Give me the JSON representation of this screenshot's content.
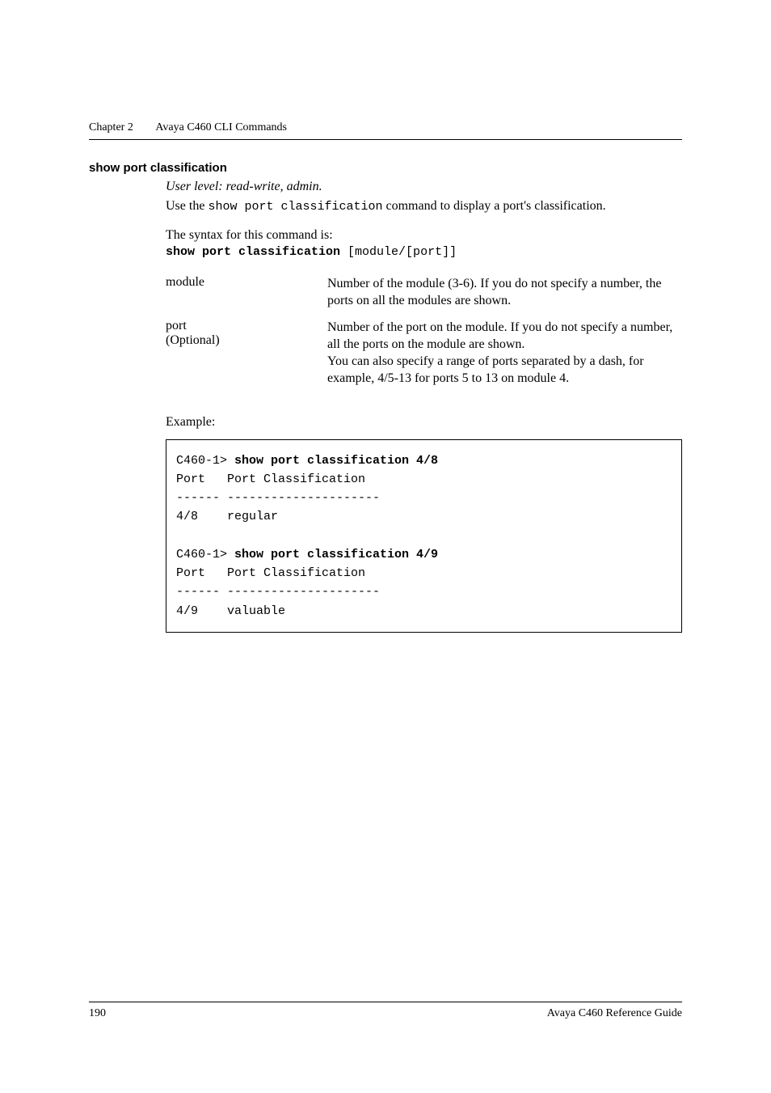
{
  "header": {
    "chapter_num": "Chapter 2",
    "chapter_title": "Avaya C460 CLI Commands"
  },
  "section": {
    "heading": "show port classification",
    "user_level": "User level: read-write, admin.",
    "intro_prefix": "Use the ",
    "intro_code": "show port classification",
    "intro_suffix": " command to display a port's classification.",
    "syntax_label": "The syntax for this command is:",
    "syntax_bold": "show port classification",
    "syntax_rest": " [module/[port]]"
  },
  "params": [
    {
      "name": "module",
      "optional": "",
      "desc": "Number of the module (3-6). If you do not specify a number, the ports on all the modules are shown."
    },
    {
      "name": "port",
      "optional": "(Optional)",
      "desc": "Number of the port on the module. If you do not specify a number, all the ports on the module are shown.",
      "desc2": "You can also specify a range of ports separated by a dash, for example, 4/5-13 for ports 5 to 13 on module 4."
    }
  ],
  "example": {
    "label": "Example:",
    "prompt1": "C460-1> ",
    "cmd1": "show port classification 4/8",
    "out1": "Port   Port Classification\n------ ---------------------\n4/8    regular",
    "prompt2": "C460-1> ",
    "cmd2": "show port classification 4/9",
    "out2": "Port   Port Classification\n------ ---------------------\n4/9    valuable"
  },
  "footer": {
    "page": "190",
    "title": "Avaya C460 Reference Guide"
  }
}
